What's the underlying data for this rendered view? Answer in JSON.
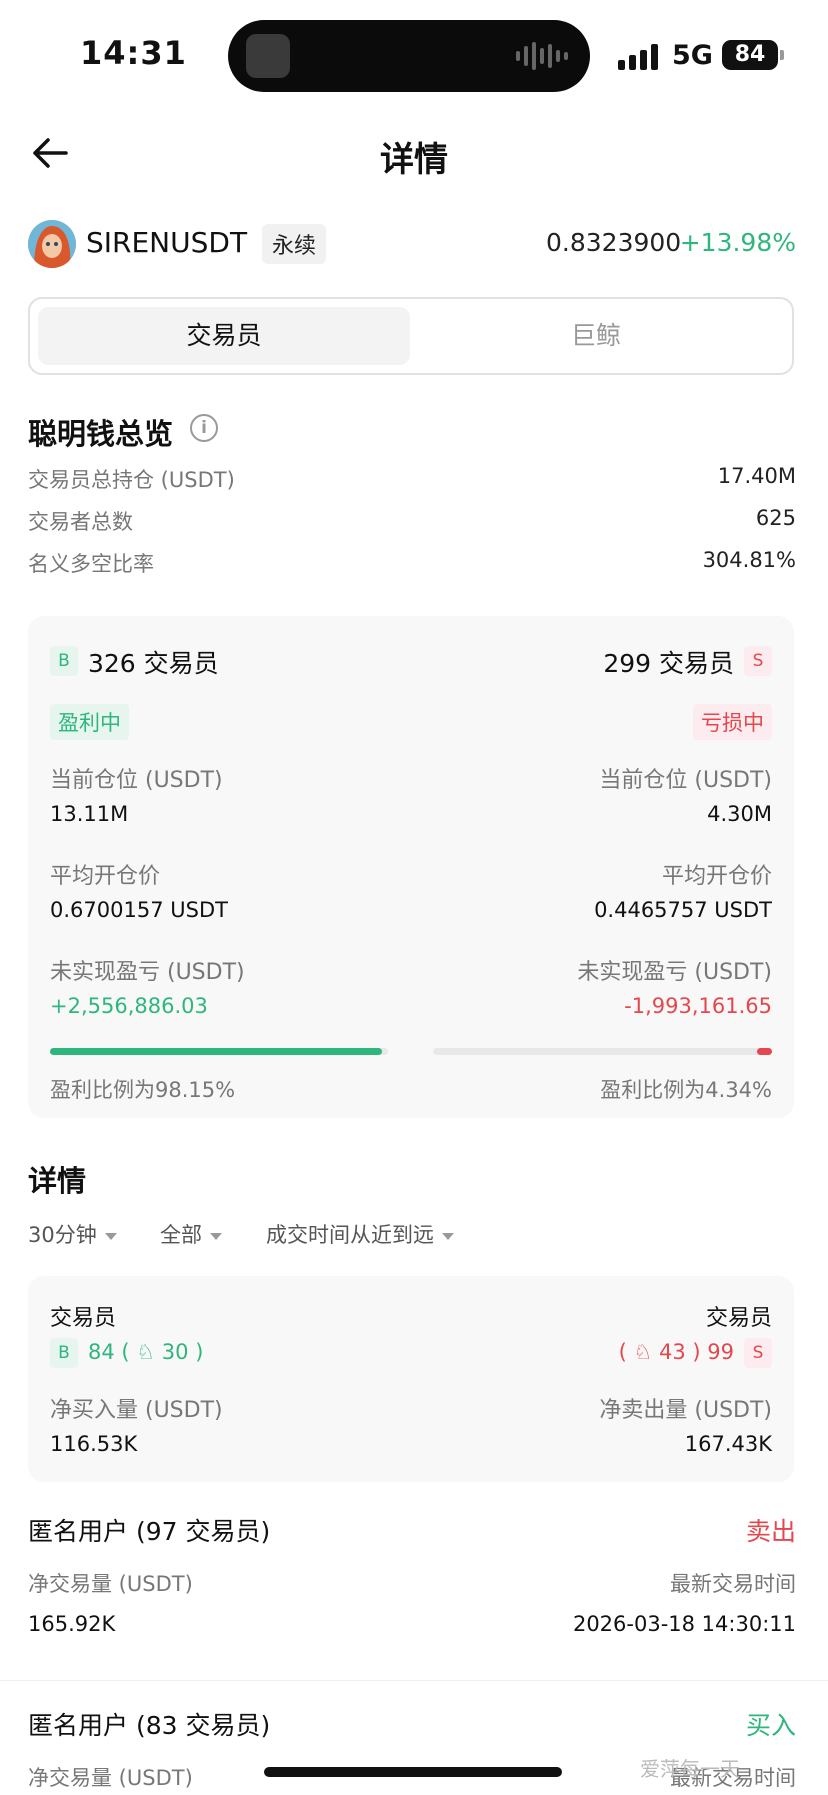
{
  "status_bar": {
    "time": "14:31",
    "network": "5G",
    "battery": "84"
  },
  "header": {
    "title": "详情"
  },
  "symbol": {
    "name": "SIRENUSDT",
    "badge": "永续",
    "price": "0.8323900",
    "change": "+13.98%"
  },
  "segment": {
    "tabs": [
      "交易员",
      "巨鲸"
    ],
    "active": 0
  },
  "overview": {
    "title": "聪明钱总览",
    "rows": [
      {
        "label": "交易员总持仓 (USDT)",
        "value": "17.40M"
      },
      {
        "label": "交易者总数",
        "value": "625"
      },
      {
        "label": "名义多空比率",
        "value": "304.81%"
      }
    ]
  },
  "summary_card": {
    "long": {
      "tag": "B",
      "count_text": "326 交易员",
      "status": "盈利中",
      "position_label": "当前仓位 (USDT)",
      "position_value": "13.11M",
      "avg_label": "平均开仓价",
      "avg_value": "0.6700157 USDT",
      "pnl_label": "未实现盈亏 (USDT)",
      "pnl_value": "+2,556,886.03",
      "ratio_text": "盈利比例为98.15%",
      "ratio": 0.9815
    },
    "short": {
      "tag": "S",
      "count_text": "299 交易员",
      "status": "亏损中",
      "position_label": "当前仓位 (USDT)",
      "position_value": "4.30M",
      "avg_label": "平均开仓价",
      "avg_value": "0.4465757 USDT",
      "pnl_label": "未实现盈亏 (USDT)",
      "pnl_value": "-1,993,161.65",
      "ratio_text": "盈利比例为4.34%",
      "ratio": 0.0434
    }
  },
  "details": {
    "title": "详情",
    "filters": [
      "30分钟",
      "全部",
      "成交时间从近到远"
    ],
    "flow_card": {
      "buy": {
        "label": "交易员",
        "tag": "B",
        "count": "84",
        "sub_count": "30",
        "amount_label": "净买入量 (USDT)",
        "amount": "116.53K"
      },
      "sell": {
        "label": "交易员",
        "tag": "S",
        "count": "99",
        "sub_count": "43",
        "amount_label": "净卖出量 (USDT)",
        "amount": "167.43K"
      }
    },
    "trades": [
      {
        "user": "匿名用户 (97 交易员)",
        "side": "卖出",
        "volume_label": "净交易量 (USDT)",
        "volume": "165.92K",
        "time_label": "最新交易时间",
        "time": "2026-03-18 14:30:11"
      },
      {
        "user": "匿名用户 (83 交易员)",
        "side": "买入",
        "volume_label": "净交易量 (USDT)",
        "time_label": "最新交易时间"
      }
    ]
  },
  "colors": {
    "green": "#2eb67d",
    "red": "#e4474e"
  },
  "watermark": "爱萍每一天"
}
